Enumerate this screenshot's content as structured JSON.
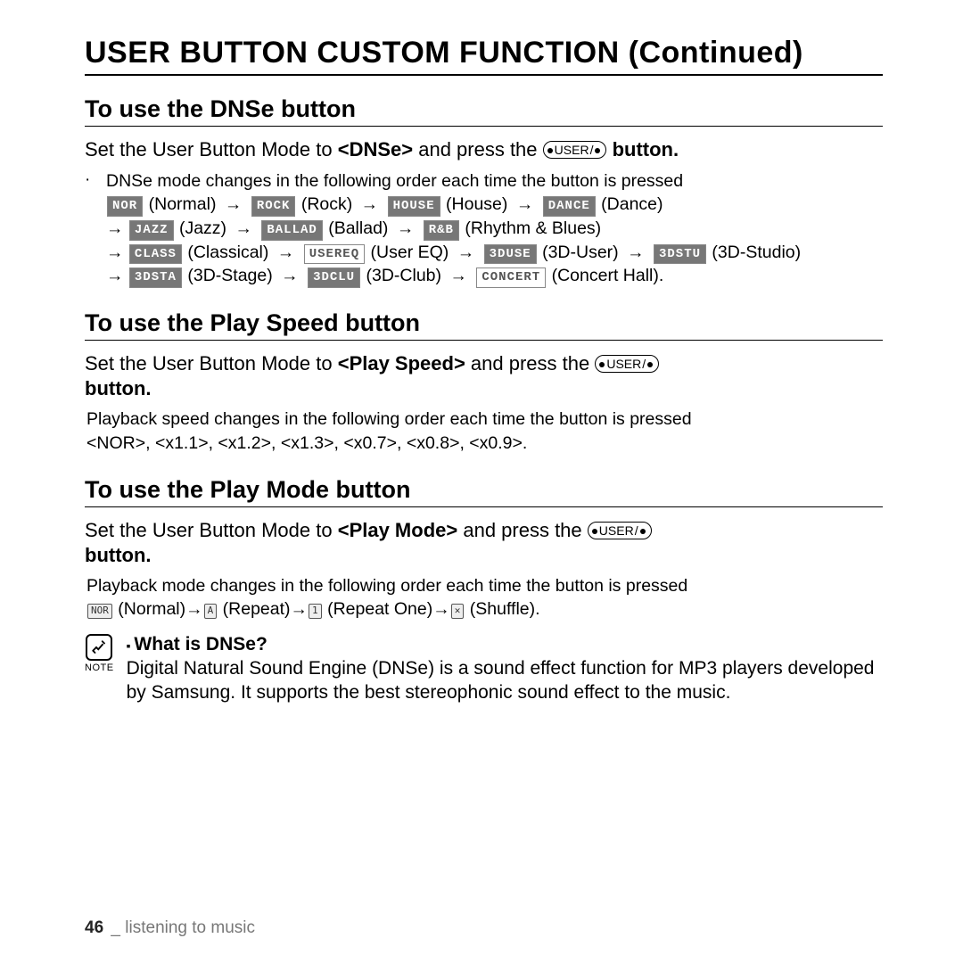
{
  "title": "USER BUTTON CUSTOM FUNCTION (Continued)",
  "userButtonLabel": "USER",
  "sections": {
    "dnse": {
      "heading": "To use the DNSe button",
      "leadPre": "Set the User Button Mode to ",
      "leadMode": "<DNSe>",
      "leadMid": " and press the ",
      "leadPost": " button.",
      "seqIntro": "DNSe mode changes in the following order each time the button is pressed",
      "modes": [
        {
          "tag": "NOR",
          "name": "Normal",
          "style": "dark"
        },
        {
          "tag": "ROCK",
          "name": "Rock",
          "style": "dark"
        },
        {
          "tag": "HOUSE",
          "name": "House",
          "style": "dark"
        },
        {
          "tag": "DANCE",
          "name": "Dance",
          "style": "dark"
        },
        {
          "tag": "JAZZ",
          "name": "Jazz",
          "style": "dark"
        },
        {
          "tag": "BALLAD",
          "name": "Ballad",
          "style": "dark"
        },
        {
          "tag": "R&B",
          "name": "Rhythm & Blues",
          "style": "dark"
        },
        {
          "tag": "CLASS",
          "name": "Classical",
          "style": "dark"
        },
        {
          "tag": "USEREQ",
          "name": "User EQ",
          "style": "outline"
        },
        {
          "tag": "3DUSE",
          "name": "3D-User",
          "style": "dark"
        },
        {
          "tag": "3DSTU",
          "name": "3D-Studio",
          "style": "dark"
        },
        {
          "tag": "3DSTA",
          "name": "3D-Stage",
          "style": "dark"
        },
        {
          "tag": "3DCLU",
          "name": "3D-Club",
          "style": "dark"
        },
        {
          "tag": "CONCERT",
          "name": "Concert Hall",
          "style": "outline"
        }
      ]
    },
    "speed": {
      "heading": "To use the Play Speed button",
      "leadPre": "Set the User Button Mode to ",
      "leadMode": "<Play Speed>",
      "leadMid": " and press the ",
      "leadPost": "button.",
      "seqIntro": "Playback speed changes in the following order each time the button is pressed",
      "values": "<NOR>, <x1.1>, <x1.2>, <x1.3>, <x0.7>, <x0.8>, <x0.9>."
    },
    "mode": {
      "heading": "To use the Play Mode button",
      "leadPre": "Set the User Button Mode to ",
      "leadMode": "<Play Mode>",
      "leadMid": " and press the ",
      "leadPost": "button.",
      "seqIntro": "Playback mode changes in the following order each time the button is pressed",
      "modes": [
        {
          "tag": "NOR",
          "name": "Normal"
        },
        {
          "tag": "A",
          "name": "Repeat"
        },
        {
          "tag": "1",
          "name": "Repeat One"
        },
        {
          "tag": "✕",
          "name": "Shuffle"
        }
      ]
    }
  },
  "note": {
    "iconLabel": "NOTE",
    "heading": "What is DNSe?",
    "body": "Digital Natural Sound Engine (DNSe) is a sound effect function for MP3 players developed by Samsung. It supports the best stereophonic sound effect to the music."
  },
  "footer": {
    "page": "46",
    "sep": "_",
    "chapter": "listening to music"
  }
}
